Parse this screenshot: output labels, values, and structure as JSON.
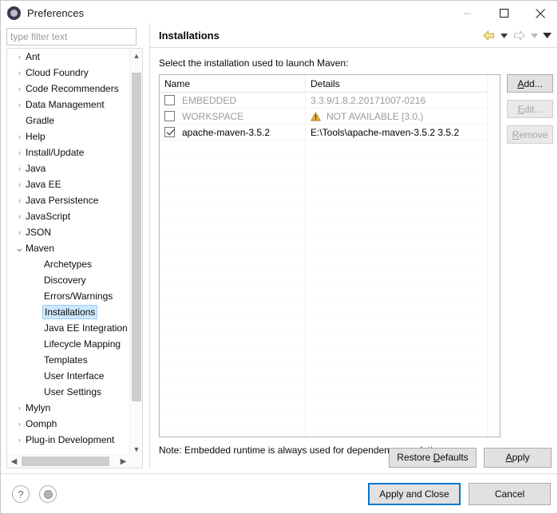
{
  "window": {
    "title": "Preferences",
    "icon": "gear-icon",
    "controls": {
      "minimize": "minimize-icon",
      "maximize": "maximize-icon",
      "close": "close-icon"
    }
  },
  "filter": {
    "placeholder": "type filter text",
    "value": ""
  },
  "tree": {
    "items": [
      {
        "label": "Ant",
        "expandable": true,
        "expanded": false,
        "child": false,
        "selected": false
      },
      {
        "label": "Cloud Foundry",
        "expandable": true,
        "expanded": false,
        "child": false,
        "selected": false
      },
      {
        "label": "Code Recommenders",
        "expandable": true,
        "expanded": false,
        "child": false,
        "selected": false
      },
      {
        "label": "Data Management",
        "expandable": true,
        "expanded": false,
        "child": false,
        "selected": false
      },
      {
        "label": "Gradle",
        "expandable": false,
        "expanded": false,
        "child": false,
        "selected": false
      },
      {
        "label": "Help",
        "expandable": true,
        "expanded": false,
        "child": false,
        "selected": false
      },
      {
        "label": "Install/Update",
        "expandable": true,
        "expanded": false,
        "child": false,
        "selected": false
      },
      {
        "label": "Java",
        "expandable": true,
        "expanded": false,
        "child": false,
        "selected": false
      },
      {
        "label": "Java EE",
        "expandable": true,
        "expanded": false,
        "child": false,
        "selected": false
      },
      {
        "label": "Java Persistence",
        "expandable": true,
        "expanded": false,
        "child": false,
        "selected": false
      },
      {
        "label": "JavaScript",
        "expandable": true,
        "expanded": false,
        "child": false,
        "selected": false
      },
      {
        "label": "JSON",
        "expandable": true,
        "expanded": false,
        "child": false,
        "selected": false
      },
      {
        "label": "Maven",
        "expandable": true,
        "expanded": true,
        "child": false,
        "selected": false
      },
      {
        "label": "Archetypes",
        "expandable": false,
        "expanded": false,
        "child": true,
        "selected": false
      },
      {
        "label": "Discovery",
        "expandable": false,
        "expanded": false,
        "child": true,
        "selected": false
      },
      {
        "label": "Errors/Warnings",
        "expandable": false,
        "expanded": false,
        "child": true,
        "selected": false
      },
      {
        "label": "Installations",
        "expandable": false,
        "expanded": false,
        "child": true,
        "selected": true
      },
      {
        "label": "Java EE Integration",
        "expandable": false,
        "expanded": false,
        "child": true,
        "selected": false
      },
      {
        "label": "Lifecycle Mapping",
        "expandable": false,
        "expanded": false,
        "child": true,
        "selected": false
      },
      {
        "label": "Templates",
        "expandable": false,
        "expanded": false,
        "child": true,
        "selected": false
      },
      {
        "label": "User Interface",
        "expandable": false,
        "expanded": false,
        "child": true,
        "selected": false
      },
      {
        "label": "User Settings",
        "expandable": false,
        "expanded": false,
        "child": true,
        "selected": false
      },
      {
        "label": "Mylyn",
        "expandable": true,
        "expanded": false,
        "child": false,
        "selected": false
      },
      {
        "label": "Oomph",
        "expandable": true,
        "expanded": false,
        "child": false,
        "selected": false
      },
      {
        "label": "Plug-in Development",
        "expandable": true,
        "expanded": false,
        "child": false,
        "selected": false
      }
    ],
    "collapsed_arrow": "›",
    "expanded_arrow": "⌄"
  },
  "page": {
    "title": "Installations",
    "description": "Select the installation used to launch Maven:",
    "note": "Note: Embedded runtime is always used for dependency resolution",
    "nav": {
      "back": "back-arrow-icon",
      "back_menu": "back-dropdown-icon",
      "forward": "forward-arrow-icon",
      "forward_menu": "forward-dropdown-icon",
      "view_menu": "view-menu-icon"
    }
  },
  "table": {
    "columns": [
      "Name",
      "Details"
    ],
    "rows": [
      {
        "checked": false,
        "enabled": false,
        "name": "EMBEDDED",
        "details": "3.3.9/1.8.2.20171007-0216",
        "warning": false
      },
      {
        "checked": false,
        "enabled": false,
        "name": "WORKSPACE",
        "details": "NOT AVAILABLE [3.0,)",
        "warning": true
      },
      {
        "checked": true,
        "enabled": true,
        "name": "apache-maven-3.5.2",
        "details": "E:\\Tools\\apache-maven-3.5.2 3.5.2",
        "warning": false
      }
    ]
  },
  "side_buttons": [
    {
      "label": "Add...",
      "enabled": true,
      "mnemonic": "A"
    },
    {
      "label": "Edit...",
      "enabled": false,
      "mnemonic": "E"
    },
    {
      "label": "Remove",
      "enabled": false,
      "mnemonic": "R"
    }
  ],
  "apply_bar": {
    "restore_defaults": "Restore Defaults",
    "restore_defaults_mnemonic": "D",
    "apply": "Apply",
    "apply_mnemonic": "A"
  },
  "footer": {
    "help_icon": "help-icon",
    "secondary_icon": "oomph-icon",
    "apply_and_close": "Apply and Close",
    "cancel": "Cancel"
  },
  "colors": {
    "selection": "#cde8ff",
    "focus_border": "#0078d7",
    "warning": "#e8b33a",
    "button_face": "#e1e1e1",
    "disabled_text": "#a6a6a6"
  }
}
